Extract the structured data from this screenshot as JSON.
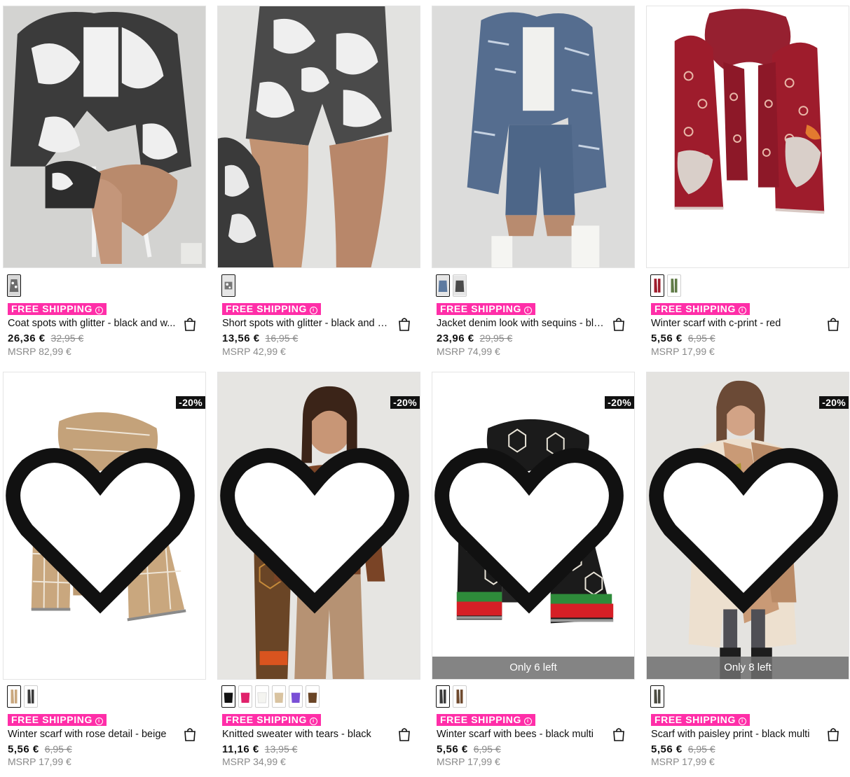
{
  "products": [
    {
      "name": "Coat spots with glitter - black and w...",
      "price": "26,36 €",
      "old_price": "32,95 €",
      "msrp": "MSRP 82,99 €",
      "shipping": "FREE SHIPPING",
      "swatches": [
        "#9a9a9a"
      ],
      "discount": "",
      "stock": ""
    },
    {
      "name": "Short spots with glitter - black and w...",
      "price": "13,56 €",
      "old_price": "16,95 €",
      "msrp": "MSRP 42,99 €",
      "shipping": "FREE SHIPPING",
      "swatches": [
        "#8d8d8d"
      ],
      "discount": "",
      "stock": ""
    },
    {
      "name": "Jacket denim look with sequins - blu...",
      "price": "23,96 €",
      "old_price": "29,95 €",
      "msrp": "MSRP 74,99 €",
      "shipping": "FREE SHIPPING",
      "swatches": [
        "#5d7aa0",
        "#4a4a4a"
      ],
      "discount": "",
      "stock": ""
    },
    {
      "name": "Winter scarf with c-print - red",
      "price": "5,56 €",
      "old_price": "6,95 €",
      "msrp": "MSRP 17,99 €",
      "shipping": "FREE SHIPPING",
      "swatches": [
        "#9e1c2c",
        "#5f7a45"
      ],
      "discount": "",
      "stock": ""
    },
    {
      "name": "Winter scarf with rose detail - beige",
      "price": "5,56 €",
      "old_price": "6,95 €",
      "msrp": "MSRP 17,99 €",
      "shipping": "FREE SHIPPING",
      "swatches": [
        "#c9a77e",
        "#3a3a3a"
      ],
      "discount": "-20%",
      "stock": ""
    },
    {
      "name": "Knitted sweater with tears - black",
      "price": "11,16 €",
      "old_price": "13,95 €",
      "msrp": "MSRP 34,99 €",
      "shipping": "FREE SHIPPING",
      "swatches": [
        "#111111",
        "#e0226b",
        "#f4f4f0",
        "#d9c3a0",
        "#7a4fd6",
        "#6a4526"
      ],
      "discount": "-20%",
      "stock": ""
    },
    {
      "name": "Winter scarf with bees - black multi",
      "price": "5,56 €",
      "old_price": "6,95 €",
      "msrp": "MSRP 17,99 €",
      "shipping": "FREE SHIPPING",
      "swatches": [
        "#3a3a3a",
        "#6f4a2e"
      ],
      "discount": "-20%",
      "stock": "Only 6 left"
    },
    {
      "name": "Scarf with paisley print - black multi",
      "price": "5,56 €",
      "old_price": "6,95 €",
      "msrp": "MSRP 17,99 €",
      "shipping": "FREE SHIPPING",
      "swatches": [
        "#4a4a40"
      ],
      "discount": "-20%",
      "stock": "Only 8 left"
    }
  ],
  "colors": {
    "shipping_badge": "#ff2ea8",
    "discount_badge": "#111111",
    "stock_bar": "#6e6e6e"
  },
  "icons": {
    "wishlist": "heart-icon",
    "cart": "shopping-bag-icon",
    "info": "info-icon"
  }
}
